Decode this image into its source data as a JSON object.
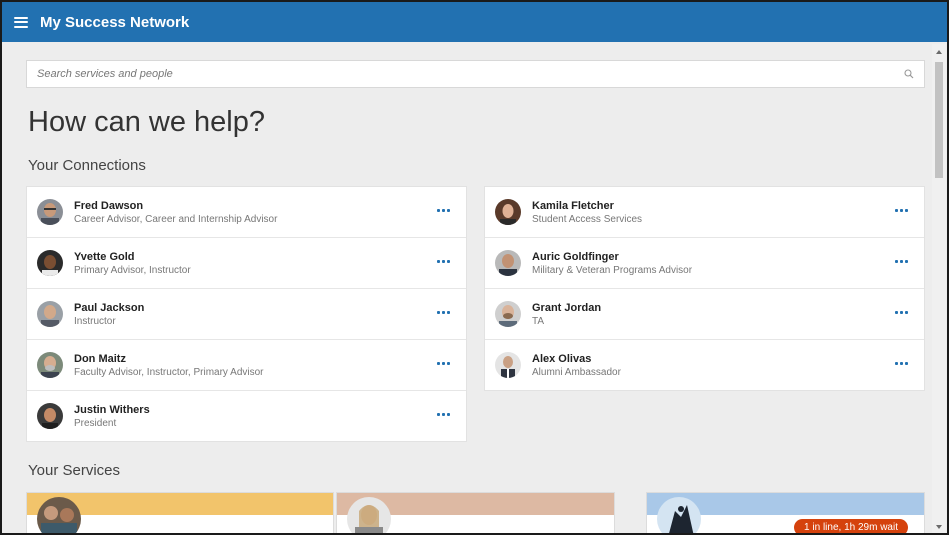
{
  "app": {
    "title": "My Success Network"
  },
  "search": {
    "placeholder": "Search services and people"
  },
  "main": {
    "heading": "How can we help?",
    "connections_title": "Your Connections",
    "services_title": "Your Services"
  },
  "connections": [
    {
      "name": "Fred Dawson",
      "role": "Career Advisor, Career and Internship Advisor"
    },
    {
      "name": "Yvette Gold",
      "role": "Primary Advisor, Instructor"
    },
    {
      "name": "Paul Jackson",
      "role": "Instructor"
    },
    {
      "name": "Don Maitz",
      "role": "Faculty Advisor, Instructor, Primary Advisor"
    },
    {
      "name": "Justin Withers",
      "role": "President"
    },
    {
      "name": "Kamila Fletcher",
      "role": "Student Access Services"
    },
    {
      "name": "Auric Goldfinger",
      "role": "Military & Veteran Programs Advisor"
    },
    {
      "name": "Grant Jordan",
      "role": "TA"
    },
    {
      "name": "Alex Olivas",
      "role": "Alumni Ambassador"
    }
  ],
  "services": [
    {
      "color": "#f2c46b",
      "icon": "group-photo-icon"
    },
    {
      "color": "#ddb9a3",
      "icon": "person-photo-icon"
    },
    {
      "color": "#a9c8e8",
      "icon": "climber-photo-icon",
      "badge": "1 in line, 1h 29m wait"
    }
  ],
  "colors": {
    "topbar": "#2271b1",
    "accent": "#2271b1",
    "badge": "#d5420d"
  }
}
